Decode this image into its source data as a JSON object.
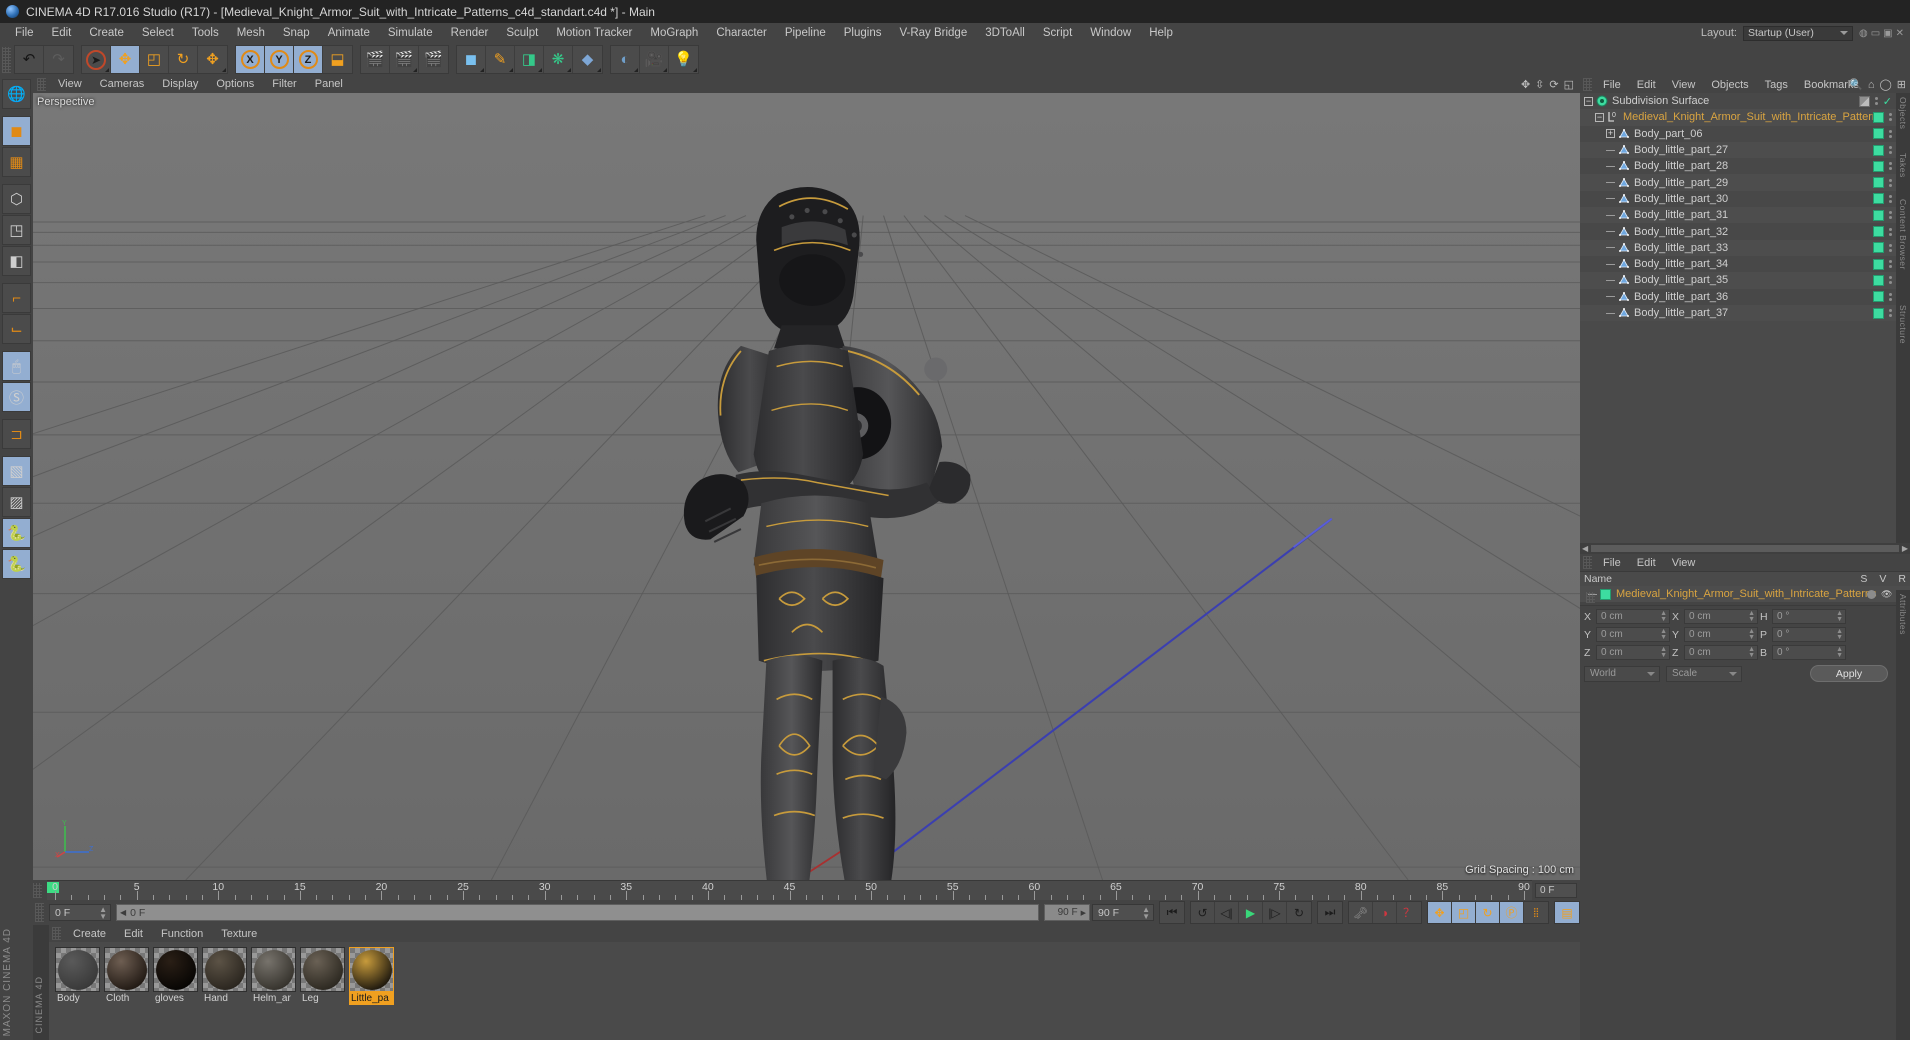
{
  "titlebar": {
    "text": "CINEMA 4D R17.016 Studio (R17) - [Medieval_Knight_Armor_Suit_with_Intricate_Patterns_c4d_standart.c4d *] - Main"
  },
  "menubar": {
    "items": [
      "File",
      "Edit",
      "Create",
      "Select",
      "Tools",
      "Mesh",
      "Snap",
      "Animate",
      "Simulate",
      "Render",
      "Sculpt",
      "Motion Tracker",
      "MoGraph",
      "Character",
      "Pipeline",
      "Plugins",
      "V-Ray Bridge",
      "3DToAll",
      "Script",
      "Window",
      "Help"
    ],
    "layout_label": "Layout:",
    "layout_value": "Startup (User)"
  },
  "toolbar": {
    "undo": "undo-arrow",
    "redo": "redo-arrow",
    "select": "select-arrow",
    "move": "move-tool",
    "scale": "scale-tool",
    "rotate": "rotate-tool",
    "axis_x": "X",
    "axis_y": "Y",
    "axis_z": "Z",
    "world": "world-coordinates",
    "render_view": "render-view",
    "render_region": "render-region",
    "render_settings": "render-settings",
    "cube": "cube-primitive",
    "spline": "spline-pen",
    "deformer": "deformer",
    "mograph": "mograph",
    "camera": "camera",
    "light": "light"
  },
  "lefttools": {
    "items": [
      "globe-axis-icon",
      "cube-model-mode-icon",
      "texture-mode-icon",
      "points-mode-icon",
      "edges-mode-icon",
      "polygons-mode-icon",
      "object-axis-icon",
      "world-axis-icon",
      "mouse-tool-icon",
      "s-snap-icon",
      "magnet-icon",
      "workplane-lock-icon",
      "workplane-icon",
      "python-icon",
      "python-generator-icon"
    ],
    "brand": "MAXON CINEMA 4D"
  },
  "viewport": {
    "menu": [
      "View",
      "Cameras",
      "Display",
      "Options",
      "Filter",
      "Panel"
    ],
    "label": "Perspective",
    "grid_spacing": "Grid Spacing : 100 cm",
    "nav_icons": [
      "pan-icon",
      "dolly-icon",
      "rotate-icon",
      "maximize-icon"
    ]
  },
  "timeline": {
    "ticks": [
      0,
      5,
      10,
      15,
      20,
      25,
      30,
      35,
      40,
      45,
      50,
      55,
      60,
      65,
      70,
      75,
      80,
      85,
      90
    ],
    "current_frame": "0 F",
    "end_frame_small": "0 F",
    "preview_end": "90 F",
    "doc_end": "90 F",
    "transport": [
      "go-to-start",
      "play-reverse",
      "step-back",
      "play",
      "step-forward",
      "play-forward-loop",
      "go-to-end"
    ],
    "record_tools": [
      "record-keyframe",
      "autokey",
      "keyframe-selection",
      "question-help"
    ],
    "anim_toggles": [
      "position-key",
      "scale-key",
      "rotation-key",
      "param-key",
      "point-level-key",
      "timeline-icon"
    ]
  },
  "materials": {
    "menu": [
      "Create",
      "Edit",
      "Function",
      "Texture"
    ],
    "items": [
      {
        "name": "Body",
        "color1": "#5a5a5a",
        "color2": "#3a3a3a",
        "selected": false
      },
      {
        "name": "Cloth",
        "color1": "#6e5e52",
        "color2": "#241c16",
        "selected": false
      },
      {
        "name": "gloves",
        "color1": "#2a1f16",
        "color2": "#080604",
        "selected": false
      },
      {
        "name": "Hand",
        "color1": "#5c5346",
        "color2": "#2c2720",
        "selected": false
      },
      {
        "name": "Helm_ar",
        "color1": "#77736c",
        "color2": "#38352f",
        "selected": false
      },
      {
        "name": "Leg",
        "color1": "#6a6155",
        "color2": "#2e2a22",
        "selected": false
      },
      {
        "name": "Little_pa",
        "color1": "#c79b3c",
        "color2": "#241d10",
        "selected": true
      }
    ]
  },
  "objectmanager": {
    "menu": [
      "File",
      "Edit",
      "View",
      "Objects",
      "Tags",
      "Bookmarks"
    ],
    "icons": [
      "search-icon",
      "home-icon",
      "ellipse-icon",
      "expand-icon"
    ],
    "rows": [
      {
        "name": "Subdivision Surface",
        "depth": 0,
        "icon": "subdivision-surface-icon",
        "expander": "minus",
        "chip": "gray",
        "check": true,
        "highlight": false
      },
      {
        "name": "Medieval_Knight_Armor_Suit_with_Intricate_Patterns",
        "depth": 1,
        "icon": "null-object-icon",
        "expander": "minus",
        "chip": "green",
        "check": false,
        "highlight": true
      },
      {
        "name": "Body_part_06",
        "depth": 2,
        "icon": "polygon-object-icon",
        "expander": "plus",
        "chip": "green",
        "check": false,
        "highlight": false
      },
      {
        "name": "Body_little_part_27",
        "depth": 2,
        "icon": "polygon-object-icon",
        "expander": "none",
        "chip": "green",
        "check": false,
        "highlight": false
      },
      {
        "name": "Body_little_part_28",
        "depth": 2,
        "icon": "polygon-object-icon",
        "expander": "none",
        "chip": "green",
        "check": false,
        "highlight": false
      },
      {
        "name": "Body_little_part_29",
        "depth": 2,
        "icon": "polygon-object-icon",
        "expander": "none",
        "chip": "green",
        "check": false,
        "highlight": false
      },
      {
        "name": "Body_little_part_30",
        "depth": 2,
        "icon": "polygon-object-icon",
        "expander": "none",
        "chip": "green",
        "check": false,
        "highlight": false
      },
      {
        "name": "Body_little_part_31",
        "depth": 2,
        "icon": "polygon-object-icon",
        "expander": "none",
        "chip": "green",
        "check": false,
        "highlight": false
      },
      {
        "name": "Body_little_part_32",
        "depth": 2,
        "icon": "polygon-object-icon",
        "expander": "none",
        "chip": "green",
        "check": false,
        "highlight": false
      },
      {
        "name": "Body_little_part_33",
        "depth": 2,
        "icon": "polygon-object-icon",
        "expander": "none",
        "chip": "green",
        "check": false,
        "highlight": false
      },
      {
        "name": "Body_little_part_34",
        "depth": 2,
        "icon": "polygon-object-icon",
        "expander": "none",
        "chip": "green",
        "check": false,
        "highlight": false
      },
      {
        "name": "Body_little_part_35",
        "depth": 2,
        "icon": "polygon-object-icon",
        "expander": "none",
        "chip": "green",
        "check": false,
        "highlight": false
      },
      {
        "name": "Body_little_part_36",
        "depth": 2,
        "icon": "polygon-object-icon",
        "expander": "none",
        "chip": "green",
        "check": false,
        "highlight": false
      },
      {
        "name": "Body_little_part_37",
        "depth": 2,
        "icon": "polygon-object-icon",
        "expander": "none",
        "chip": "green",
        "check": false,
        "highlight": false
      }
    ],
    "side_tabs": [
      "Objects",
      "Takes",
      "Content Browser",
      "Structure"
    ]
  },
  "layermanager": {
    "menu": [
      "File",
      "Edit",
      "View"
    ],
    "name_col": "Name",
    "columns": [
      "S",
      "V",
      "R"
    ],
    "row": "Medieval_Knight_Armor_Suit_with_Intricate_Patterns"
  },
  "coordinates": {
    "header": [
      "--",
      "--",
      "--"
    ],
    "position": {
      "label_x": "X",
      "x": "0 cm",
      "label_y": "Y",
      "y": "0 cm",
      "label_z": "Z",
      "z": "0 cm"
    },
    "size": {
      "label_x": "X",
      "x": "0 cm",
      "label_y": "Y",
      "y": "0 cm",
      "label_z": "Z",
      "z": "0 cm"
    },
    "rotation": {
      "label_h": "H",
      "h": "0 °",
      "label_p": "P",
      "p": "0 °",
      "label_b": "B",
      "b": "0 °"
    },
    "system": "World",
    "mode": "Scale",
    "apply": "Apply",
    "side_tab": "Attributes"
  }
}
